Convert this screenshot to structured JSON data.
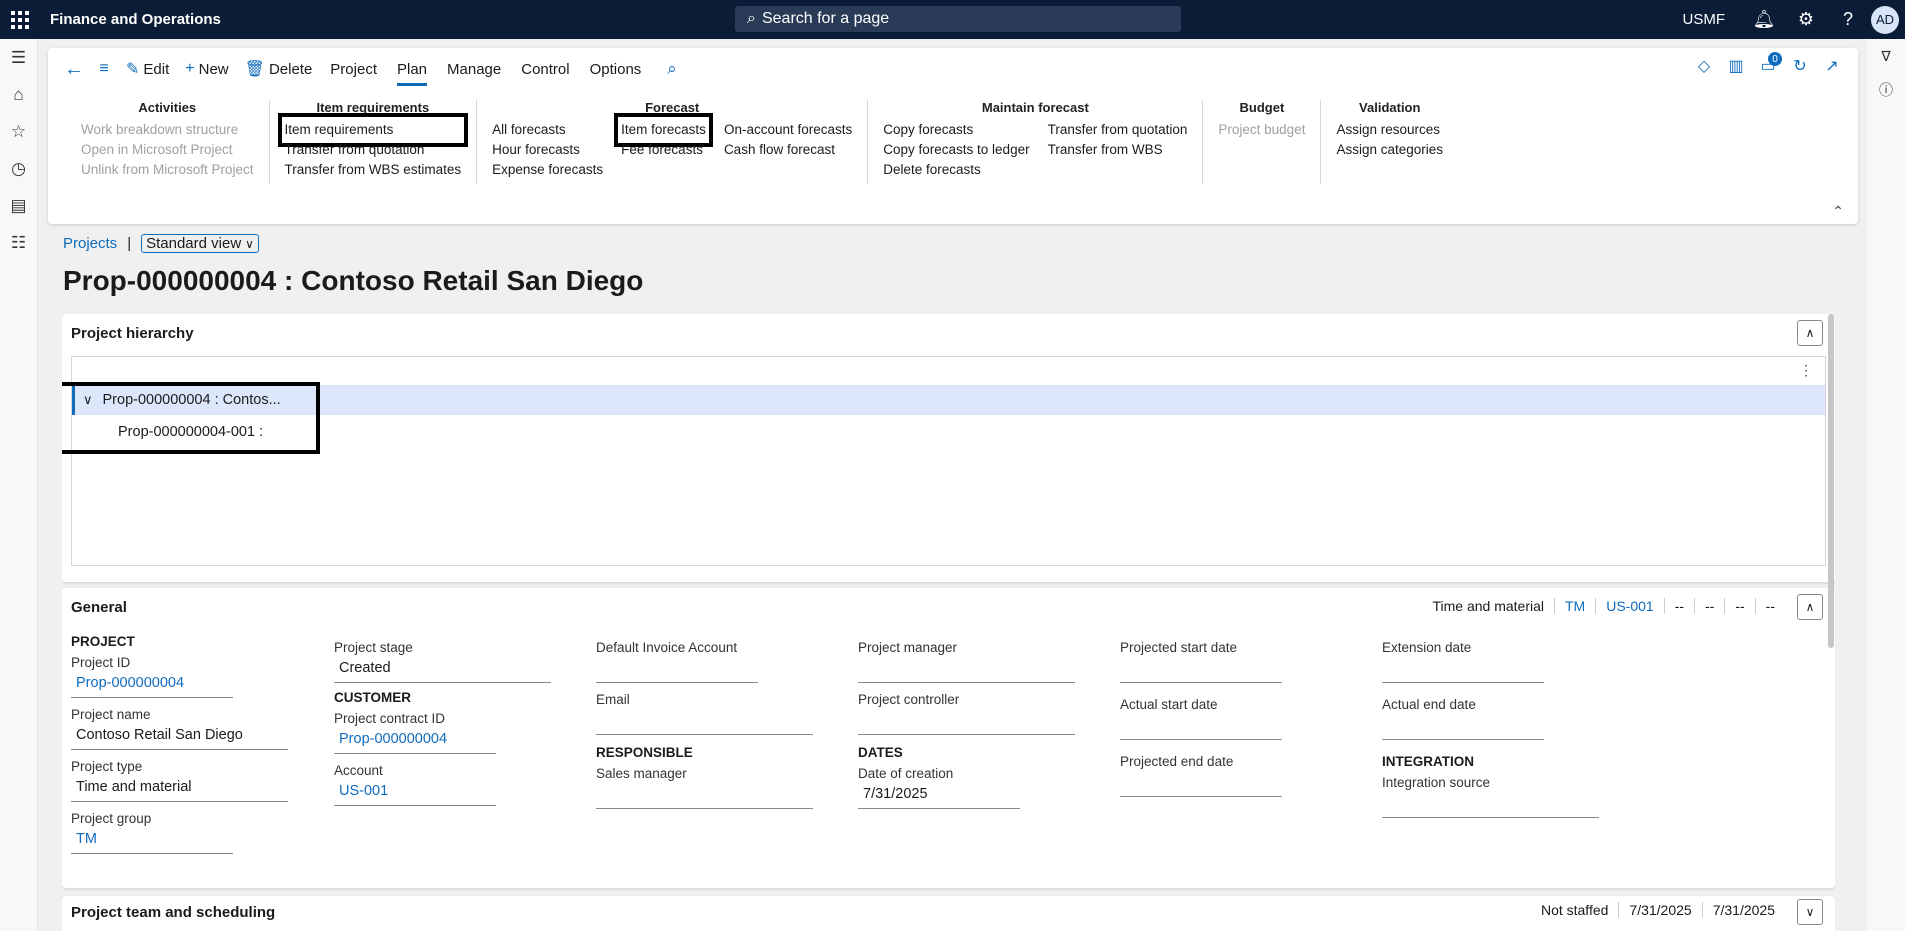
{
  "topbar": {
    "app_title": "Finance and Operations",
    "search_placeholder": "Search for a page",
    "company": "USMF",
    "avatar_initials": "AD"
  },
  "actionpane": {
    "buttons": {
      "edit": "Edit",
      "new": "New",
      "delete": "Delete"
    },
    "tabs": [
      "Project",
      "Plan",
      "Manage",
      "Control",
      "Options"
    ],
    "active_tab": "Plan",
    "notification_count": "0",
    "groups": {
      "activities": {
        "title": "Activities",
        "items": [
          "Work breakdown structure",
          "Open in Microsoft Project",
          "Unlink from Microsoft Project"
        ]
      },
      "item_requirements": {
        "title": "Item requirements",
        "items": [
          "Item requirements",
          "Transfer from quotation",
          "Transfer from WBS estimates"
        ]
      },
      "forecast": {
        "title": "Forecast",
        "col1": [
          "All forecasts",
          "Hour forecasts",
          "Expense forecasts"
        ],
        "col2": [
          "Item forecasts",
          "Fee forecasts"
        ],
        "col3": [
          "On-account forecasts",
          "Cash flow forecast"
        ]
      },
      "maintain_forecast": {
        "title": "Maintain forecast",
        "col1": [
          "Copy forecasts",
          "Copy forecasts to ledger",
          "Delete forecasts"
        ],
        "col2": [
          "Transfer from quotation",
          "Transfer from WBS"
        ]
      },
      "budget": {
        "title": "Budget",
        "items": [
          "Project budget"
        ]
      },
      "validation": {
        "title": "Validation",
        "items": [
          "Assign resources",
          "Assign categories"
        ]
      }
    }
  },
  "breadcrumb": {
    "link": "Projects",
    "separator": "|",
    "view": "Standard view"
  },
  "page_title": "Prop-000000004 : Contoso Retail San Diego",
  "hierarchy": {
    "title": "Project hierarchy",
    "root": "Prop-000000004 : Contos...",
    "child": "Prop-000000004-001 :"
  },
  "general": {
    "title": "General",
    "summary": [
      "Time and material",
      "TM",
      "US-001",
      "--",
      "--",
      "--",
      "--"
    ],
    "project": {
      "section": "PROJECT",
      "project_id_label": "Project ID",
      "project_id": "Prop-000000004",
      "project_name_label": "Project name",
      "project_name": "Contoso Retail San Diego",
      "project_type_label": "Project type",
      "project_type": "Time and material",
      "project_group_label": "Project group",
      "project_group": "TM"
    },
    "col2": {
      "stage_label": "Project stage",
      "stage": "Created",
      "customer_section": "CUSTOMER",
      "contract_label": "Project contract ID",
      "contract": "Prop-000000004",
      "account_label": "Account",
      "account": "US-001"
    },
    "col3": {
      "invoice_label": "Default Invoice Account",
      "invoice": "",
      "email_label": "Email",
      "email": "",
      "responsible_section": "RESPONSIBLE",
      "sales_manager_label": "Sales manager",
      "sales_manager": ""
    },
    "col4": {
      "manager_label": "Project manager",
      "manager": "",
      "controller_label": "Project controller",
      "controller": "",
      "dates_section": "DATES",
      "creation_label": "Date of creation",
      "creation": "7/31/2025"
    },
    "col5": {
      "proj_start_label": "Projected start date",
      "proj_start": "",
      "actual_start_label": "Actual start date",
      "actual_start": "",
      "proj_end_label": "Projected end date",
      "proj_end": ""
    },
    "col6": {
      "extension_label": "Extension date",
      "extension": "",
      "actual_end_label": "Actual end date",
      "actual_end": "",
      "integration_section": "INTEGRATION",
      "integration_label": "Integration source",
      "integration": ""
    }
  },
  "team": {
    "title": "Project team and scheduling",
    "summary": [
      "Not staffed",
      "7/31/2025",
      "7/31/2025"
    ]
  }
}
